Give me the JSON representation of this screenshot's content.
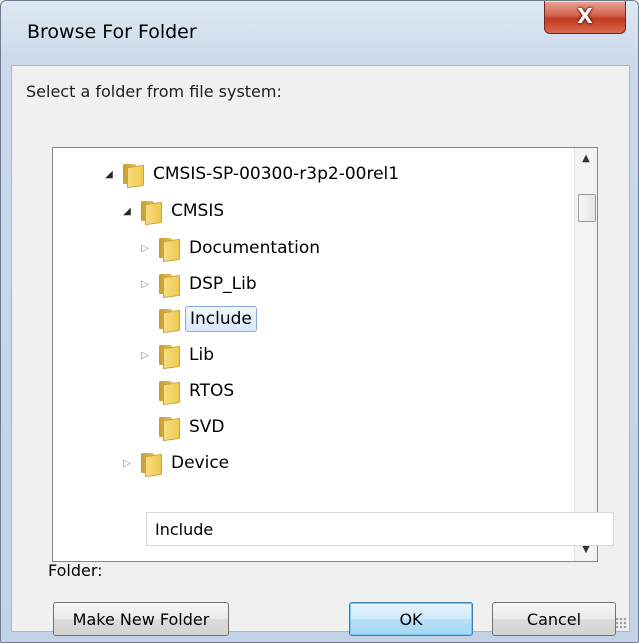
{
  "window": {
    "title": "Browse For Folder",
    "close_symbol": "X"
  },
  "prompt": "Select a folder from file system:",
  "tree": {
    "items": [
      {
        "label": "CMSIS-SP-00300-r3p2-00rel1",
        "expander": "open"
      },
      {
        "label": "CMSIS",
        "expander": "open"
      },
      {
        "label": "Documentation",
        "expander": "closed"
      },
      {
        "label": "DSP_Lib",
        "expander": "closed"
      },
      {
        "label": "Include",
        "expander": "none",
        "selected": true
      },
      {
        "label": "Lib",
        "expander": "closed"
      },
      {
        "label": "RTOS",
        "expander": "none"
      },
      {
        "label": "SVD",
        "expander": "none"
      },
      {
        "label": "Device",
        "expander": "closed"
      }
    ],
    "icon": "folder-icon"
  },
  "folder_field": {
    "label": "Folder:",
    "value": "Include"
  },
  "buttons": {
    "make_new_folder": "Make New Folder",
    "ok": "OK",
    "cancel": "Cancel"
  }
}
